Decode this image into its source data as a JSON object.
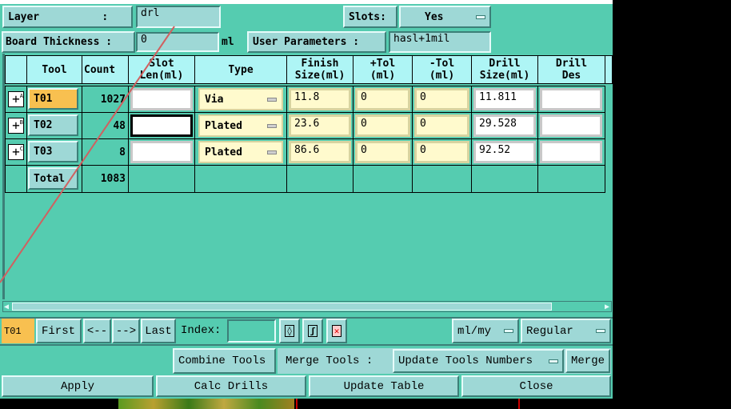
{
  "header": {
    "layer_label": "Layer          :",
    "layer_value": "drl",
    "slots_label": "Slots:",
    "slots_value": "Yes",
    "thickness_label": "Board Thickness :",
    "thickness_value": "0",
    "thickness_unit": "ml",
    "user_params_label": "User Parameters :",
    "user_params_value": "hasl+1mil"
  },
  "table": {
    "columns": [
      "Tool",
      "Count",
      "Slot Len(ml)",
      "Type",
      "Finish Size(ml)",
      "+Tol (ml)",
      "-Tol (ml)",
      "Drill Size(ml)",
      "Drill Des"
    ],
    "rows": [
      {
        "marker": "A",
        "tool": "T01",
        "count": "1027",
        "slot": "",
        "type": "Via",
        "finish": "11.8",
        "ptol": "0",
        "mtol": "0",
        "drill": "11.811",
        "des": ""
      },
      {
        "marker": "B",
        "tool": "T02",
        "count": "48",
        "slot": "",
        "type": "Plated",
        "finish": "23.6",
        "ptol": "0",
        "mtol": "0",
        "drill": "29.528",
        "des": ""
      },
      {
        "marker": "C",
        "tool": "T03",
        "count": "8",
        "slot": "",
        "type": "Plated",
        "finish": "86.6",
        "ptol": "0",
        "mtol": "0",
        "drill": "92.52",
        "des": ""
      }
    ],
    "total_label": "Total",
    "total_count": "1083"
  },
  "nav": {
    "current": "T01",
    "first": "First",
    "prev": "<--",
    "next": "-->",
    "last": "Last",
    "index_label": "Index:",
    "index_value": "",
    "units": "ml/my",
    "mode": "Regular"
  },
  "actions": {
    "combine": "Combine Tools",
    "merge_label": "Merge Tools :",
    "merge_option": "Update Tools Numbers",
    "merge": "Merge",
    "apply": "Apply",
    "calc": "Calc Drills",
    "update": "Update Table",
    "close": "Close"
  },
  "colors": {
    "bg": "#55ccb0",
    "button": "#9ed8d6",
    "header": "#aef5f5",
    "highlight": "#f8c050",
    "input_yellow": "#fffacd"
  }
}
